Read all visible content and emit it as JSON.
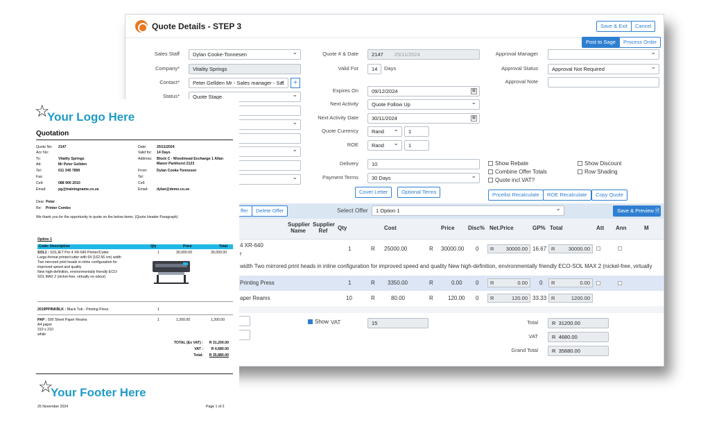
{
  "window": {
    "title": "Quote Details - STEP 3",
    "buttons": {
      "save_exit": "Save & Exit",
      "cancel": "Cancel",
      "post_sage": "Post to Sage",
      "process_order": "Process Order"
    }
  },
  "form_left": {
    "sales_staff_label": "Sales Staff",
    "sales_staff": "Dylan Cooke-Tonnesen",
    "company_label": "Company*",
    "company": "Vitality Springs",
    "contact_label": "Contact*",
    "contact": "Peter Gellden Mr - Sales manager - Sal",
    "status_label": "Status*",
    "status": "Quote Stage"
  },
  "form_mid": {
    "quote_date_label": "Quote # & Date",
    "quote_no": "2147",
    "quote_date": "25/11/2024",
    "valid_for_label": "Valid For",
    "valid_for": "14",
    "days": "Days",
    "expires_label": "Expires On",
    "expires": "09/12/2024",
    "next_activity_label": "Next Activity",
    "next_activity": "Quote Follow Up",
    "next_activity_date_label": "Next Activity Date",
    "next_activity_date": "30/11/2024",
    "currency_label": "Quote Currency",
    "currency": "Rand",
    "currency_rate": "1",
    "roe_label": "ROE",
    "roe_currency": "Rand",
    "roe_rate": "1",
    "delivery_label": "Delivery",
    "delivery": "10",
    "payment_label": "Payment Terms",
    "payment": "30 Days"
  },
  "form_right": {
    "approval_manager_label": "Approval Manager",
    "approval_manager": "",
    "approval_status_label": "Approval Status",
    "approval_status": "Approval Not Required",
    "approval_note_label": "Approval Note",
    "approval_note": ""
  },
  "options": {
    "show_rebate": "Show Rebate",
    "show_discount": "Show Discount",
    "combine_offer": "Combine Offer Totals",
    "row_shading": "Row Shading",
    "quote_incl_vat": "Quote incl VAT?"
  },
  "action_buttons": {
    "cover_letter": "Cover Letter",
    "optional_terms": "Optional Terms",
    "pricelist_recalc": "Pricelist Recalculate",
    "roe_recalc": "ROE Recalculate",
    "copy_quote": "Copy Quote",
    "offer": "ffer",
    "delete_offer": "Delete Offer",
    "select_offer_label": "Select Offer",
    "select_offer": "1 Option 1",
    "save_preview": "Save & Preview"
  },
  "grid": {
    "headers": {
      "supplier_name": "Supplier Name",
      "supplier_ref": "Supplier Ref",
      "qty": "Qty",
      "cost": "Cost",
      "price": "Price",
      "disc": "Disc%",
      "net_price": "Net.Price",
      "gp": "GP%",
      "total": "Total",
      "att": "Att",
      "ann": "Ann",
      "m": "M"
    },
    "rows": [
      {
        "desc": "4 XR-640",
        "desc2": "r",
        "qty": "1",
        "cur": "R",
        "cost": "25000.00",
        "price": "30000.00",
        "disc": "0",
        "net": "30000.00",
        "gp": "16.67",
        "total": "30000.00"
      },
      {
        "desc": "Printing Press",
        "qty": "1",
        "cur": "R",
        "cost": "3350.00",
        "price": "0.00",
        "disc": "0",
        "net": "0.00",
        "gp": "0",
        "total": "0.00"
      },
      {
        "desc": "aper Reams",
        "qty": "10",
        "cur": "R",
        "cost": "80.00",
        "price": "120.00",
        "disc": "0",
        "net": "120.00",
        "gp": "33.33",
        "total": "1200.00"
      }
    ],
    "long_text": "width Two mirrored print heads in inline configuration for improved speed and quality New high-definition, environmentally friendly ECO-SOL MAX 2 (nickel-free, virtually"
  },
  "totals": {
    "show_vat": "Show",
    "vat_label": "VAT",
    "vat_rate": "15",
    "total_label": "Total",
    "total": "31200.00",
    "vat_amt_label": "VAT",
    "vat_amt": "4680.00",
    "grand_label": "Grand Total",
    "grand": "35880.00",
    "cur": "R"
  },
  "doc": {
    "logo": "Your Logo Here",
    "heading": "Quotation",
    "info_left": [
      [
        "Quote No:",
        "2147"
      ],
      [
        "Acc No:",
        ""
      ],
      [
        "To:",
        "Vitality Springs"
      ],
      [
        "Att:",
        "Mr Peter Gellden"
      ],
      [
        "Tel:",
        "011 345 7890"
      ],
      [
        "Fax:",
        ""
      ],
      [
        "Cell:",
        "088 900 2010"
      ],
      [
        "Email:",
        "pg@trainingname.co.za"
      ]
    ],
    "info_right": [
      [
        "Date:",
        "25/11/2024"
      ],
      [
        "Valid for:",
        "14 Days"
      ],
      [
        "Address:",
        "Block C - Woodmead Exchange 1 Allan"
      ],
      [
        "",
        "Manor Parkhurst 2123"
      ],
      [
        "From:",
        "Dylan Cooke-Tonnesen"
      ],
      [
        "Tel:",
        ""
      ],
      [
        "Cell:",
        ""
      ],
      [
        "Email:",
        "dylan@demo.co.za"
      ]
    ],
    "dear_label": "Dear",
    "dear": "Peter",
    "re_label": "Re:",
    "re": "Printer Combo",
    "intro": "We thank you for the opportunity to quote on the below items. (Quote Header Paragraph)",
    "option": "Option 1",
    "cols": {
      "code": "Code: Description",
      "qty": "Qty",
      "price": "Price",
      "total": "Total"
    },
    "item1_code": "SOL1 :",
    "item1_title": "SOLJET Pro 4 XR-640 Printer/Cutter",
    "item1_qty": "1",
    "item1_price": "30,000.00",
    "item1_total": "30,000.00",
    "item1_lines": [
      "Large-format printer/cutter with 64 (162.56 cm) width",
      "Two mirrored print heads in inline configuration for",
      "improved speed and quality",
      "New high-definition, environmentally friendly ECO-",
      "SOL MAX 2 (nickel-free, virtually no odour)"
    ],
    "item2_code": "2019PPINKBLK :",
    "item2_title": "Black Tub - Printing Press",
    "item2_qty": "1",
    "item3_code": "PAP :",
    "item3_title": "500 Sheet Paper Reams",
    "item3_qty": "1",
    "item3_price": "1,200.00",
    "item3_total": "1,200.00",
    "item3_lines": [
      "A4 paper",
      "310 x 210",
      "white"
    ],
    "sum_ex_label": "TOTAL (Ex VAT) :",
    "sum_ex": "R 31,200.00",
    "sum_vat_label": "VAT :",
    "sum_vat": "R 4,680.00",
    "sum_total_label": "Total:",
    "sum_total": "R 35,880.00",
    "footer": "Your Footer Here",
    "footer_date": "25 November 2024",
    "page": "Page 1 of 2"
  }
}
